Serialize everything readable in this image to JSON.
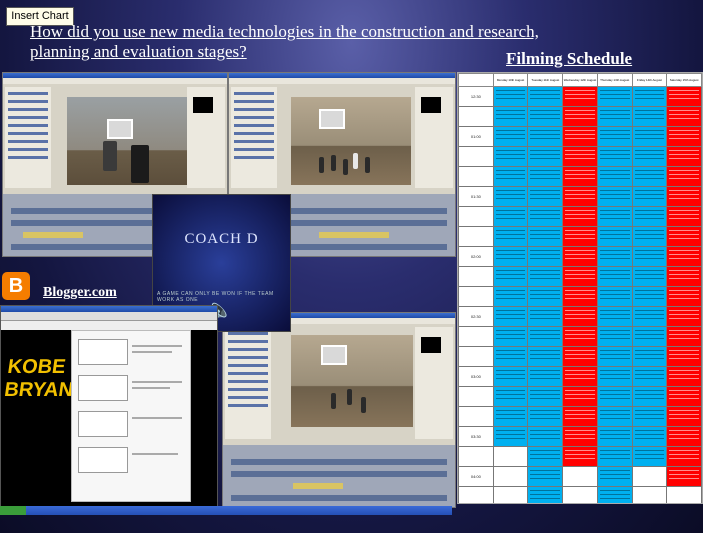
{
  "toolbar": {
    "insert_chart_label": "Insert Chart"
  },
  "slide": {
    "title_line1": "How did you use new media technologies in the construction and research,",
    "title_line2": "planning and evaluation stages?",
    "filming_schedule": "Filming Schedule",
    "blogger_label": "Blogger.com"
  },
  "coach": {
    "title": "COACH D",
    "subtitle": "A GAME CAN ONLY BE WON IF THE TEAM WORK AS ONE"
  },
  "schedule": {
    "day_headers": [
      "",
      "Monday 10th August",
      "Tuesday 11th August",
      "Wednesday 12th August",
      "Thursday 13th August",
      "Friday 14th August",
      "Saturday 15th August"
    ],
    "times": [
      "12:30",
      "",
      "01:00",
      "",
      "",
      "01:30",
      "",
      "",
      "02:00",
      "",
      "",
      "02:30",
      "",
      "",
      "03:00",
      "",
      "",
      "03:30",
      "",
      "04:00",
      "",
      "04:30"
    ],
    "column_colors": [
      "cyan",
      "cyan",
      "red",
      "cyan",
      "cyan",
      "red"
    ],
    "colors": {
      "cyan": "#00b0f0",
      "red": "#ff0000"
    }
  }
}
